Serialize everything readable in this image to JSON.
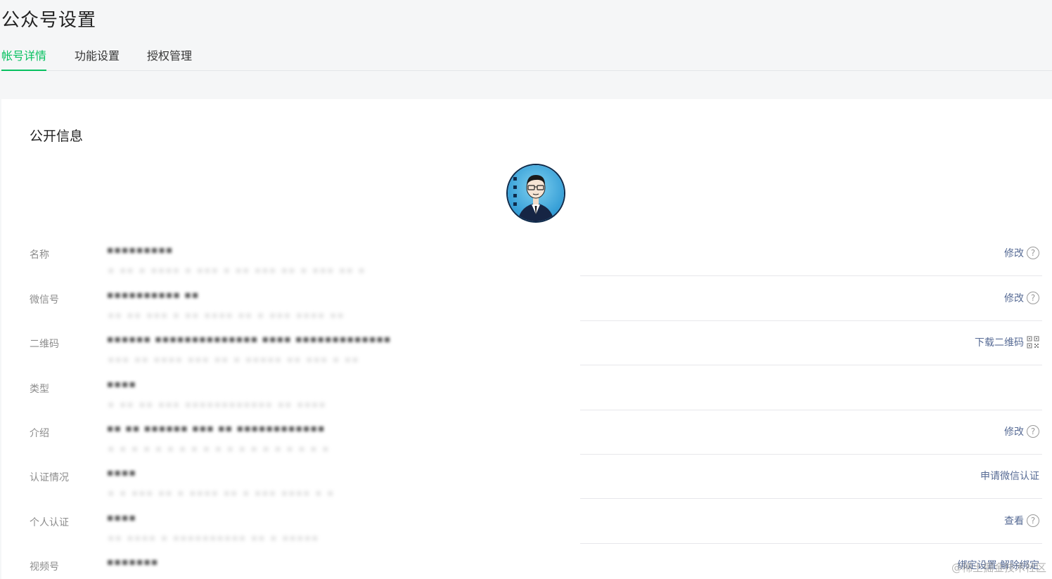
{
  "page": {
    "title": "公众号设置"
  },
  "tabs": [
    {
      "label": "帐号详情",
      "active": true
    },
    {
      "label": "功能设置",
      "active": false
    },
    {
      "label": "授权管理",
      "active": false
    }
  ],
  "section": {
    "title": "公开信息"
  },
  "rows": [
    {
      "label": "名称",
      "value": "▪▪▪▪▪▪▪▪▪",
      "ghost": "▪ ▪▪ ▪ ▪▪▪▪ ▪ ▪▪▪ ▪ ▪▪ ▪▪▪ ▪▪ ▪ ▪▪▪ ▪▪ ▪",
      "action": "修改",
      "action_icon": "help-icon"
    },
    {
      "label": "微信号",
      "value": "▪▪▪▪▪▪▪▪▪▪ ▪▪",
      "ghost": "▪▪ ▪▪ ▪▪▪ ▪ ▪▪ ▪▪▪▪ ▪▪ ▪ ▪▪▪ ▪▪▪▪ ▪▪",
      "action": "修改",
      "action_icon": "help-icon"
    },
    {
      "label": "二维码",
      "value": "▪▪▪▪▪▪ ▪▪▪▪▪▪▪▪▪▪▪▪▪▪ ▪▪▪▪ ▪▪▪▪▪▪▪▪▪▪▪▪▪",
      "ghost": "▪▪▪ ▪▪ ▪▪▪▪ ▪▪▪ ▪▪ ▪ ▪▪▪▪▪ ▪▪ ▪▪▪ ▪ ▪▪",
      "action": "下载二维码",
      "action_icon": "qr-code-icon"
    },
    {
      "label": "类型",
      "value": "▪▪▪▪",
      "ghost": "▪ ▪▪ ▪▪ ▪▪▪ ▪▪▪▪▪▪▪▪▪▪▪▪ ▪▪ ▪▪▪▪",
      "action": "",
      "action_icon": ""
    },
    {
      "label": "介绍",
      "value": "▪▪ ▪▪ ▪▪▪▪▪▪ ▪▪▪ ▪▪ ▪▪▪▪▪▪▪▪▪▪▪▪",
      "ghost": "▪ ▪ ▪ ▪ ▪ ▪ ▪ ▪ ▪ ▪ ▪ ▪ ▪ ▪ ▪ ▪ ▪ ▪ ▪",
      "action": "修改",
      "action_icon": "help-icon"
    },
    {
      "label": "认证情况",
      "value": "▪▪▪▪",
      "ghost": "▪ ▪ ▪▪▪ ▪▪ ▪ ▪▪▪▪ ▪▪ ▪ ▪▪▪ ▪▪▪▪ ▪ ▪",
      "action": "申请微信认证",
      "action_icon": ""
    },
    {
      "label": "个人认证",
      "value": "▪▪▪▪",
      "ghost": "▪▪ ▪▪▪▪ ▪ ▪▪▪▪▪▪▪▪▪▪ ▪▪ ▪ ▪▪▪▪▪",
      "action": "查看",
      "action_icon": "help-icon"
    },
    {
      "label": "视频号",
      "value": "▪▪▪▪▪▪▪",
      "ghost": "",
      "action": "绑定设置 解除绑定",
      "action_icon": ""
    }
  ],
  "watermark": "@稀土掘金技术社区",
  "colors": {
    "accent": "#07c160",
    "link": "#576b95",
    "label": "#8c8c8c"
  }
}
